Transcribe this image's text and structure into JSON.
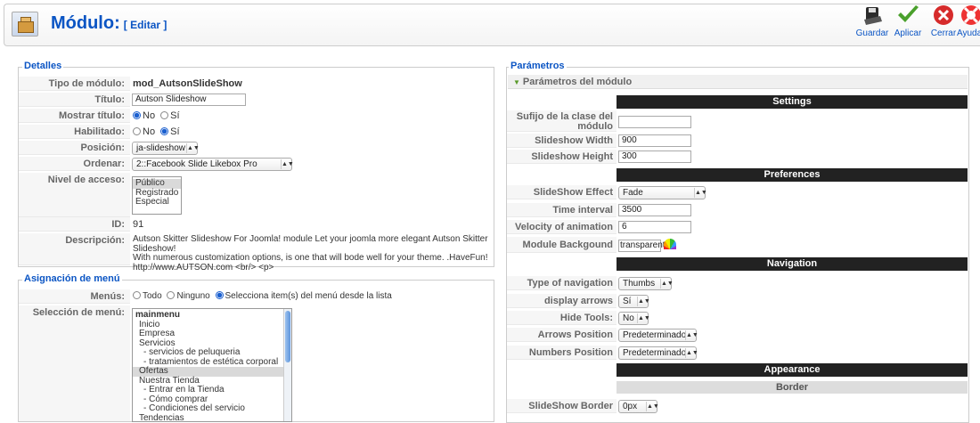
{
  "header": {
    "title": "Módulo:",
    "subtitle": "[ Editar ]",
    "toolbar": {
      "save": "Guardar",
      "apply": "Aplicar",
      "close": "Cerrar",
      "help": "Ayuda"
    }
  },
  "details": {
    "legend": "Detalles",
    "module_type_label": "Tipo de módulo:",
    "module_type": "mod_AutsonSlideShow",
    "title_label": "Título:",
    "title_value": "Autson Slideshow",
    "show_title_label": "Mostrar título:",
    "show_title_no": "No",
    "show_title_yes": "Sí",
    "enabled_label": "Habilitado:",
    "enabled_no": "No",
    "enabled_yes": "Sí",
    "position_label": "Posición:",
    "position_value": "ja-slideshow",
    "order_label": "Ordenar:",
    "order_value": "2::Facebook Slide Likebox Pro",
    "access_label": "Nivel de acceso:",
    "access_options": [
      "Público",
      "Registrado",
      "Especial"
    ],
    "id_label": "ID:",
    "id_value": "91",
    "desc_label": "Descripción:",
    "desc_line1": "Autson Skitter Slideshow For Joomla! module Let your joomla more elegant Autson Skitter Slideshow!",
    "desc_line2": "With numerous customization options, is one that will bode well for your theme. .HaveFun!",
    "desc_line3": "http://www.AUTSON.com <br/> <p>"
  },
  "menu_assign": {
    "legend": "Asignación de menú",
    "menus_label": "Menús:",
    "opt_all": "Todo",
    "opt_none": "Ninguno",
    "opt_select": "Selecciona item(s) del menú desde la lista",
    "selection_label": "Selección de menú:",
    "items": [
      "mainmenu",
      "Inicio",
      "Empresa",
      "Servicios",
      "- servicios de peluqueria",
      "- tratamientos de estética corporal",
      "Ofertas",
      "Nuestra Tienda",
      "- Entrar en la Tienda",
      "- Cómo comprar",
      "- Condiciones del servicio",
      "Tendencias"
    ]
  },
  "params": {
    "legend": "Parámetros",
    "panel_title": "Parámetros del módulo",
    "settings": "Settings",
    "suffix_label": "Sufijo de la clase del módulo",
    "width_label": "Slideshow Width",
    "width_value": "900",
    "height_label": "Slideshow Height",
    "height_value": "300",
    "preferences": "Preferences",
    "effect_label": "SlideShow Effect",
    "effect_value": "Fade",
    "interval_label": "Time interval",
    "interval_value": "3500",
    "velocity_label": "Velocity of animation",
    "velocity_value": "6",
    "bg_label": "Module Backgound",
    "bg_value": "transparent",
    "navigation": "Navigation",
    "nav_type_label": "Type of navigation",
    "nav_type_value": "Thumbs",
    "arrows_label": "display arrows",
    "arrows_value": "Sí",
    "hide_tools_label": "Hide Tools:",
    "hide_tools_value": "No",
    "arrows_pos_label": "Arrows Position",
    "arrows_pos_value": "Predeterminado",
    "numbers_pos_label": "Numbers Position",
    "numbers_pos_value": "Predeterminado",
    "appearance": "Appearance",
    "border": "Border",
    "ss_border_label": "SlideShow Border",
    "ss_border_value": "0px"
  }
}
